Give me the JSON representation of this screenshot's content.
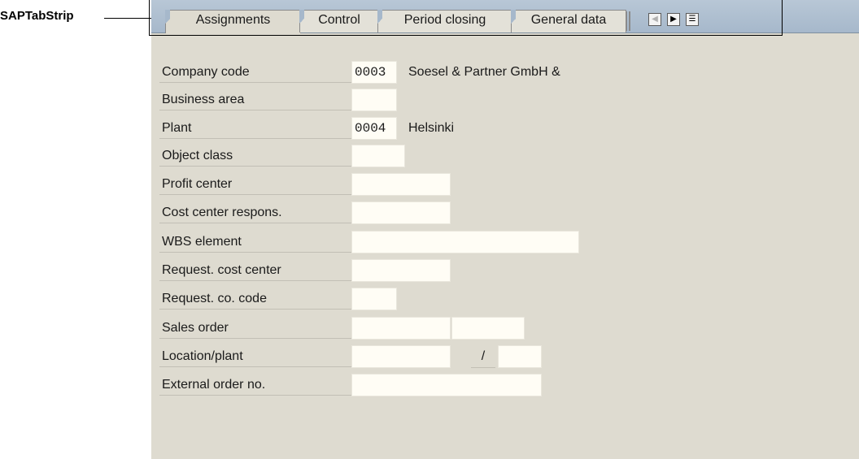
{
  "callout": {
    "text": "SAPTabStrip"
  },
  "tabs": [
    {
      "label": "Assignments",
      "active": true
    },
    {
      "label": "Control",
      "active": false
    },
    {
      "label": "Period closing",
      "active": false
    },
    {
      "label": "General data",
      "active": false
    }
  ],
  "tab_nav": {
    "prev_icon": "scroll-left-icon",
    "next_icon": "scroll-right-icon",
    "list_icon": "tab-list-icon"
  },
  "form": {
    "company_code": {
      "label": "Company code",
      "value": "0003",
      "description": "Soesel & Partner GmbH &"
    },
    "business_area": {
      "label": "Business area",
      "value": ""
    },
    "plant": {
      "label": "Plant",
      "value": "0004",
      "description": "Helsinki"
    },
    "object_class": {
      "label": "Object class",
      "value": ""
    },
    "profit_center": {
      "label": "Profit center",
      "value": ""
    },
    "cost_center_respons": {
      "label": "Cost center respons.",
      "value": ""
    },
    "wbs_element": {
      "label": "WBS element",
      "value": ""
    },
    "request_cost_center": {
      "label": "Request. cost center",
      "value": ""
    },
    "request_co_code": {
      "label": "Request. co. code",
      "value": ""
    },
    "sales_order": {
      "label": "Sales order",
      "value": "",
      "item_value": ""
    },
    "location_plant": {
      "label": "Location/plant",
      "location_value": "",
      "separator": "/",
      "plant_value": ""
    },
    "external_order_no": {
      "label": "External order no.",
      "value": ""
    }
  }
}
